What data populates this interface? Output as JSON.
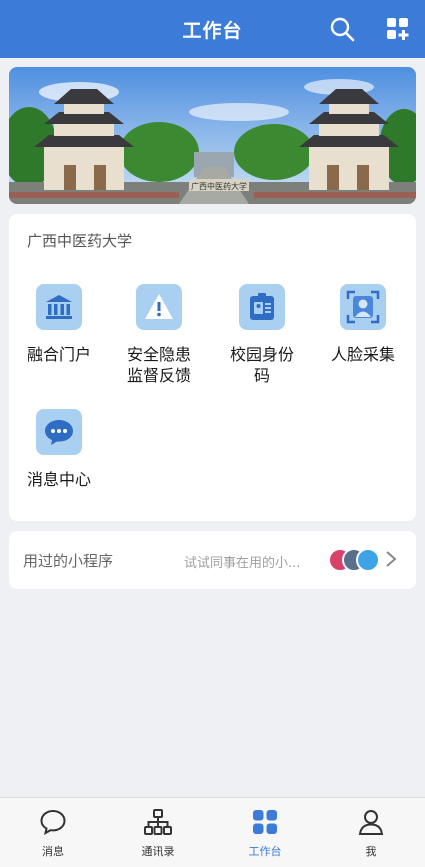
{
  "header": {
    "title": "工作台",
    "search_icon": "search-icon",
    "add_app_icon": "grid-plus-icon"
  },
  "banner": {
    "image": "campus-gate-photo",
    "gate_text": "广西中医药大学"
  },
  "apps_section": {
    "title": "广西中医药大学",
    "apps": [
      {
        "label": "融合门户",
        "icon": "bank-building-icon"
      },
      {
        "label": "安全隐患\n监督反馈",
        "icon": "warning-icon"
      },
      {
        "label": "校园身份\n码",
        "icon": "id-badge-icon"
      },
      {
        "label": "人脸采集",
        "icon": "face-scan-icon"
      },
      {
        "label": "消息中心",
        "icon": "chat-bubble-icon"
      }
    ]
  },
  "mini_programs": {
    "title": "用过的小程序",
    "hint": "试试同事在用的小...",
    "arrow_icon": "chevron-right-icon"
  },
  "tabbar": {
    "tabs": [
      {
        "label": "消息",
        "icon": "message-icon",
        "active": false
      },
      {
        "label": "通讯录",
        "icon": "org-chart-icon",
        "active": false
      },
      {
        "label": "工作台",
        "icon": "grid-icon",
        "active": true
      },
      {
        "label": "我",
        "icon": "person-icon",
        "active": false
      }
    ]
  },
  "colors": {
    "primary": "#3d7bd8",
    "app_icon_bg": "#a9d0f0",
    "background": "#eef0f3"
  }
}
